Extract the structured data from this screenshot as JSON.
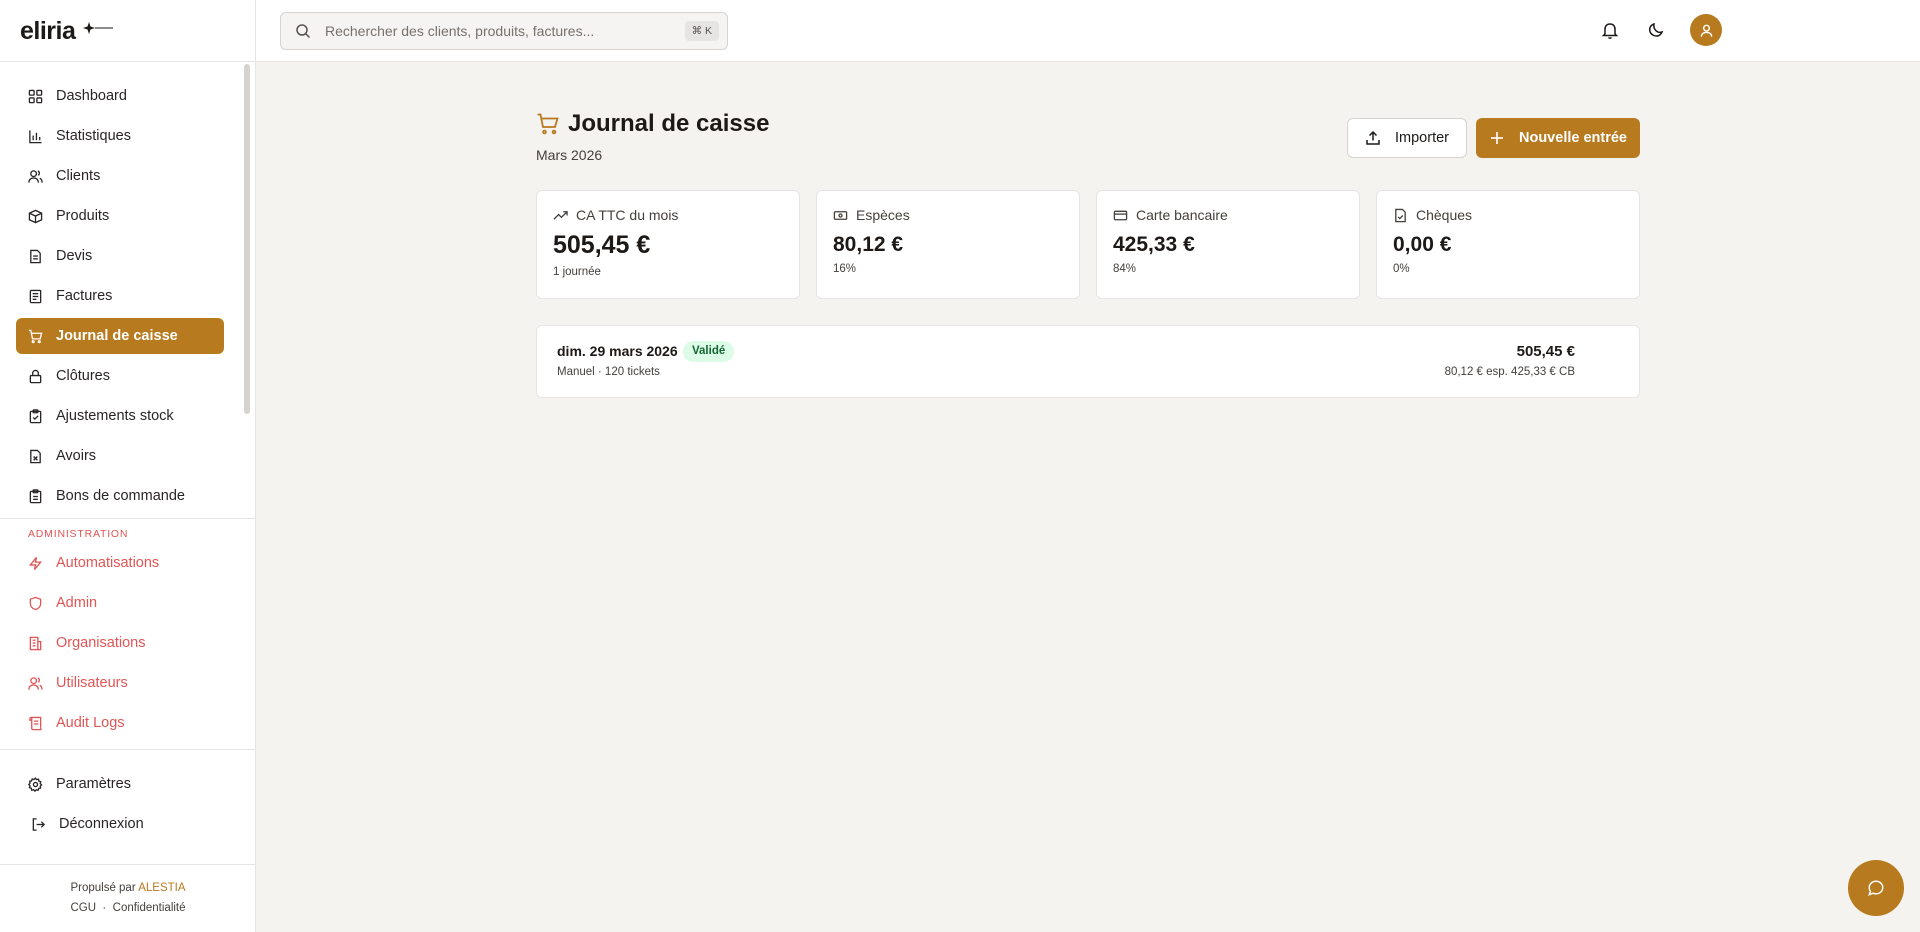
{
  "app": {
    "logo": "eliria"
  },
  "search": {
    "placeholder": "Rechercher des clients, produits, factures...",
    "shortcut": "⌘ K"
  },
  "sidebar": {
    "items": [
      {
        "label": "Dashboard",
        "icon": "dashboard-icon"
      },
      {
        "label": "Statistiques",
        "icon": "bar-chart-icon"
      },
      {
        "label": "Clients",
        "icon": "users-icon"
      },
      {
        "label": "Produits",
        "icon": "package-icon"
      },
      {
        "label": "Devis",
        "icon": "document-icon"
      },
      {
        "label": "Factures",
        "icon": "receipt-icon"
      },
      {
        "label": "Journal de caisse",
        "icon": "cart-icon",
        "active": true
      },
      {
        "label": "Clôtures",
        "icon": "lock-icon"
      },
      {
        "label": "Ajustements stock",
        "icon": "clipboard-check-icon"
      },
      {
        "label": "Avoirs",
        "icon": "file-x-icon"
      },
      {
        "label": "Bons de commande",
        "icon": "clipboard-list-icon"
      }
    ],
    "admin_title": "ADMINISTRATION",
    "admin_items": [
      {
        "label": "Automatisations",
        "icon": "zap-icon"
      },
      {
        "label": "Admin",
        "icon": "shield-icon"
      },
      {
        "label": "Organisations",
        "icon": "building-icon"
      },
      {
        "label": "Utilisateurs",
        "icon": "users-icon"
      },
      {
        "label": "Audit Logs",
        "icon": "scroll-icon"
      }
    ],
    "bottom": {
      "settings": "Paramètres",
      "logout": "Déconnexion"
    },
    "footer": {
      "powered": "Propulsé par",
      "brand": "ALESTIA",
      "cgu": "CGU",
      "dot": "·",
      "privacy": "Confidentialité"
    }
  },
  "page": {
    "title": "Journal de caisse",
    "subtitle": "Mars 2026",
    "import_label": "Importer",
    "new_label": "Nouvelle entrée"
  },
  "cards": [
    {
      "label": "CA TTC du mois",
      "value": "505,45 €",
      "sub": "1 journée",
      "icon": "trending-up-icon"
    },
    {
      "label": "Espèces",
      "value": "80,12 €",
      "sub": "16%",
      "icon": "banknote-icon"
    },
    {
      "label": "Carte bancaire",
      "value": "425,33 €",
      "sub": "84%",
      "icon": "credit-card-icon"
    },
    {
      "label": "Chèques",
      "value": "0,00 €",
      "sub": "0%",
      "icon": "file-check-icon"
    }
  ],
  "entries": [
    {
      "date": "dim. 29 mars 2026",
      "status": "Validé",
      "meta": "Manuel  · 120 tickets",
      "total": "505,45 €",
      "detail": "80,12 € esp. 425,33 € CB"
    }
  ],
  "colors": {
    "accent": "#b87a1e",
    "admin": "#e05555",
    "background": "#f5f3ef",
    "success_bg": "#dcfce7",
    "success_text": "#166534"
  }
}
